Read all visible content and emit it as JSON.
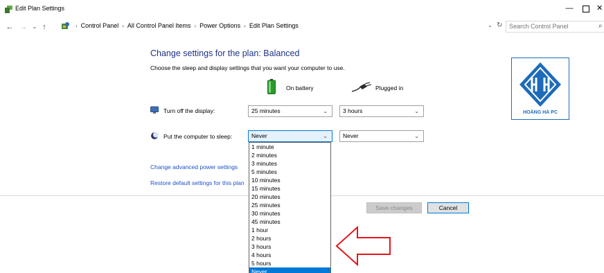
{
  "window": {
    "title": "Edit Plan Settings",
    "minimize_glyph": "—",
    "close_glyph": "✕"
  },
  "nav": {
    "back_glyph": "←",
    "forward_glyph": "→",
    "recent_glyph": "⌄",
    "up_glyph": "↑",
    "breadcrumbs": [
      "Control Panel",
      "All Control Panel Items",
      "Power Options",
      "Edit Plan Settings"
    ],
    "separator": "›",
    "dropdown_glyph": "⌄",
    "refresh_glyph": "↻",
    "search_placeholder": "Search Control Panel",
    "search_glyph": "⌕"
  },
  "main": {
    "heading": "Change settings for the plan: Balanced",
    "subheading": "Choose the sleep and display settings that you want your computer to use.",
    "columns": {
      "battery": "On battery",
      "plugged": "Plugged in"
    },
    "display": {
      "label": "Turn off the display:",
      "on_battery": "25 minutes",
      "plugged_in": "3 hours"
    },
    "sleep": {
      "label": "Put the computer to sleep:",
      "on_battery": "Never",
      "plugged_in": "Never"
    },
    "dropdown_options": [
      "1 minute",
      "2 minutes",
      "3 minutes",
      "5 minutes",
      "10 minutes",
      "15 minutes",
      "20 minutes",
      "25 minutes",
      "30 minutes",
      "45 minutes",
      "1 hour",
      "2 hours",
      "3 hours",
      "4 hours",
      "5 hours",
      "Never"
    ],
    "dropdown_highlighted": "Never",
    "advanced_link": "Change advanced power settings",
    "restore_link": "Restore default settings for this plan",
    "save_button": "Save changes",
    "cancel_button": "Cancel",
    "chevron_glyph": "⌄"
  },
  "logo": {
    "text": "HOÀNG HÀ PC"
  },
  "colors": {
    "heading": "#1e3287",
    "link": "#1e50c8",
    "highlight": "#0078d7",
    "arrow": "#e0161b",
    "logo_blue": "#1d6bb8"
  }
}
